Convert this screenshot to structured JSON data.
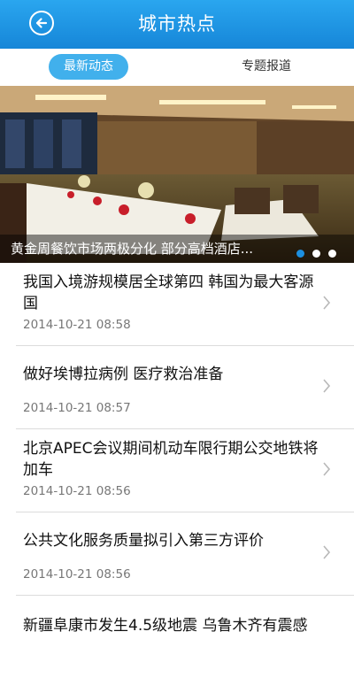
{
  "header": {
    "title": "城市热点",
    "back_icon": "back-arrow-icon"
  },
  "tabs": [
    {
      "label": "最新动态",
      "active": true
    },
    {
      "label": "专题报道",
      "active": false
    }
  ],
  "banner": {
    "caption": "黄金周餐饮市场两极分化 部分高档酒店...",
    "slide_count": 3,
    "active_slide": 1
  },
  "news": [
    {
      "title": "我国入境游规模居全球第四 韩国为最大客源国",
      "time": "2014-10-21 08:58"
    },
    {
      "title": "做好埃博拉病例 医疗救治准备",
      "time": "2014-10-21 08:57"
    },
    {
      "title": "北京APEC会议期间机动车限行期公交地铁将加车",
      "time": "2014-10-21 08:56"
    },
    {
      "title": "公共文化服务质量拟引入第三方评价",
      "time": "2014-10-21 08:56"
    },
    {
      "title": "新疆阜康市发生4.5级地震 乌鲁木齐有震感",
      "time": ""
    }
  ],
  "colors": {
    "header": "#1e95e4",
    "tab_active": "#41b0ec",
    "dot_active": "#1c8fe0"
  }
}
